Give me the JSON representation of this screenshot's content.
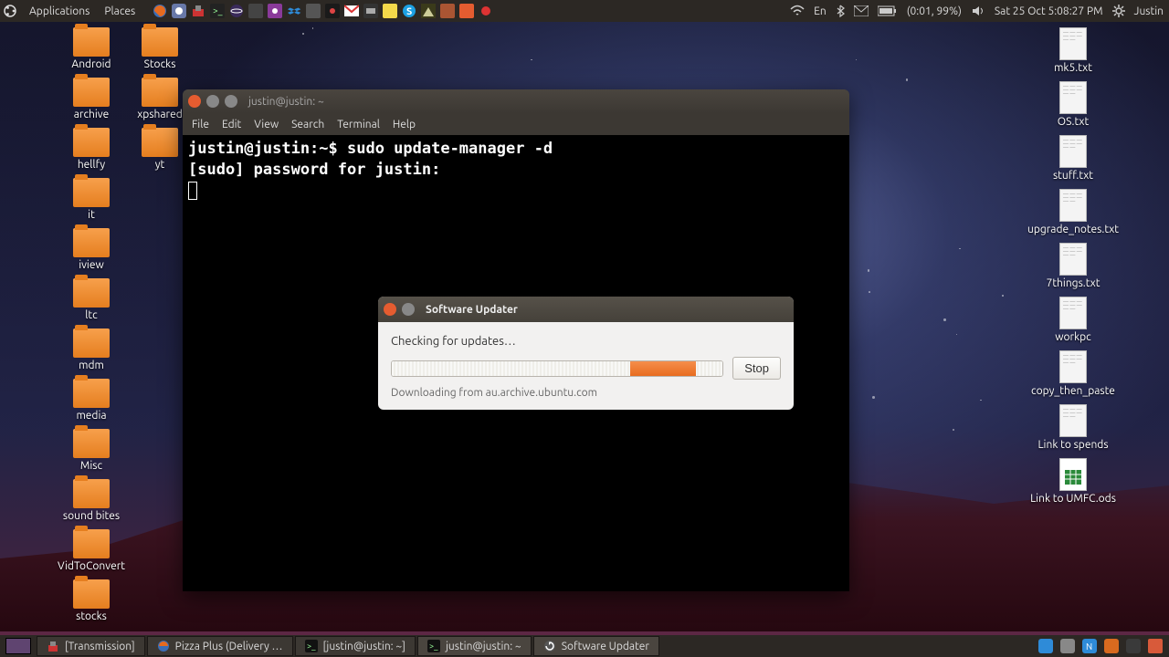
{
  "top_panel": {
    "menu": {
      "applications": "Applications",
      "places": "Places"
    },
    "tray": {
      "lang": "En",
      "battery": "(0:01, 99%)",
      "clock": "Sat 25 Oct  5:08:27 PM",
      "user": "Justin"
    }
  },
  "desktop": {
    "left": [
      "Android",
      "archive",
      "hellfy",
      "it",
      "iview",
      "ltc",
      "mdm",
      "media",
      "Misc",
      "sound bites",
      "VidToConvert",
      "stocks"
    ],
    "left2": [
      "Stocks",
      "xpshared",
      "yt"
    ],
    "right": [
      {
        "label": "mk5.txt",
        "type": "text"
      },
      {
        "label": "OS.txt",
        "type": "text"
      },
      {
        "label": "stuff.txt",
        "type": "text"
      },
      {
        "label": "upgrade_notes.txt",
        "type": "text"
      },
      {
        "label": "7things.txt",
        "type": "text"
      },
      {
        "label": "workpc",
        "type": "text"
      },
      {
        "label": "copy_then_paste",
        "type": "text"
      },
      {
        "label": "Link to spends",
        "type": "link"
      },
      {
        "label": "Link to UMFC.ods",
        "type": "ods"
      }
    ]
  },
  "terminal": {
    "title": "justin@justin: ~",
    "menus": [
      "File",
      "Edit",
      "View",
      "Search",
      "Terminal",
      "Help"
    ],
    "line1": "justin@justin:~$ sudo update-manager -d",
    "line2": "[sudo] password for justin:"
  },
  "updater": {
    "title": "Software Updater",
    "status": "Checking for updates…",
    "stop": "Stop",
    "detail": "Downloading from au.archive.ubuntu.com"
  },
  "taskbar": {
    "tasks": [
      {
        "label": "[Transmission]"
      },
      {
        "label": "Pizza Plus (Delivery …"
      },
      {
        "label": "[justin@justin: ~]"
      },
      {
        "label": "justin@justin: ~"
      },
      {
        "label": "Software Updater"
      }
    ]
  }
}
